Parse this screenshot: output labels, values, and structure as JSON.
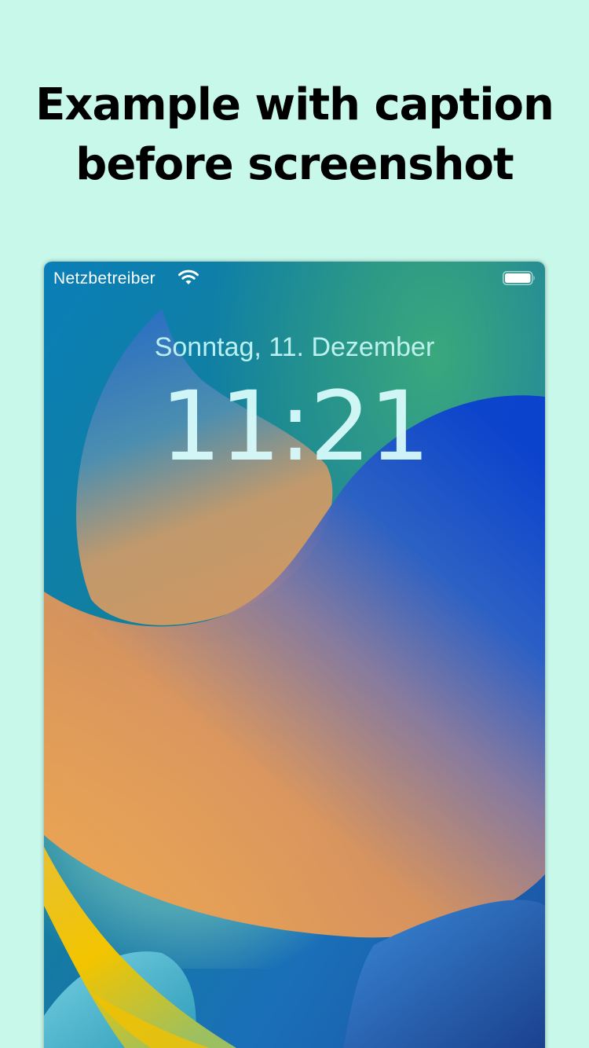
{
  "caption": {
    "line1": "Example with caption",
    "line2": "before screenshot"
  },
  "status_bar": {
    "carrier": "Netzbetreiber",
    "wifi_icon": "wifi-icon",
    "battery_icon": "battery-full-icon"
  },
  "lock_screen": {
    "date": "Sonntag, 11. Dezember",
    "time": "11:21"
  },
  "colors": {
    "page_background": "#c8f8ea",
    "caption_text": "#000000"
  }
}
